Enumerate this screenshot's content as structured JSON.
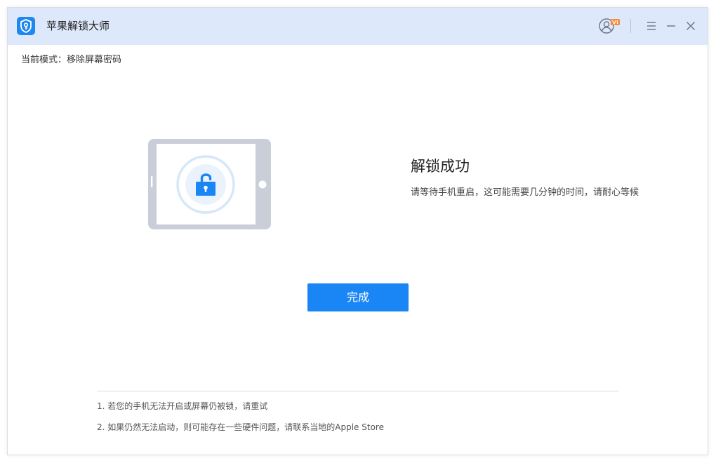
{
  "window": {
    "title": "苹果解锁大师",
    "icons": {
      "app": "shield-key-icon",
      "user": "user-vip-icon",
      "menu": "menu-icon",
      "minimize": "minimize-icon",
      "close": "close-icon"
    }
  },
  "mode": {
    "label": "当前模式：移除屏幕密码"
  },
  "result": {
    "illustration": "tablet-unlocked-icon",
    "title": "解锁成功",
    "description": "请等待手机重启，这可能需要几分钟的时间，请耐心等候"
  },
  "actions": {
    "done_label": "完成"
  },
  "tips": [
    "1. 若您的手机无法开启或屏幕仍被锁，请重试",
    "2. 如果仍然无法启动，则可能存在一些硬件问题，请联系当地的Apple Store"
  ],
  "colors": {
    "titlebar_bg": "#dde9fb",
    "accent": "#1a85f5",
    "vip_badge": "#f5883a",
    "tablet_frame": "#c9ced8"
  }
}
